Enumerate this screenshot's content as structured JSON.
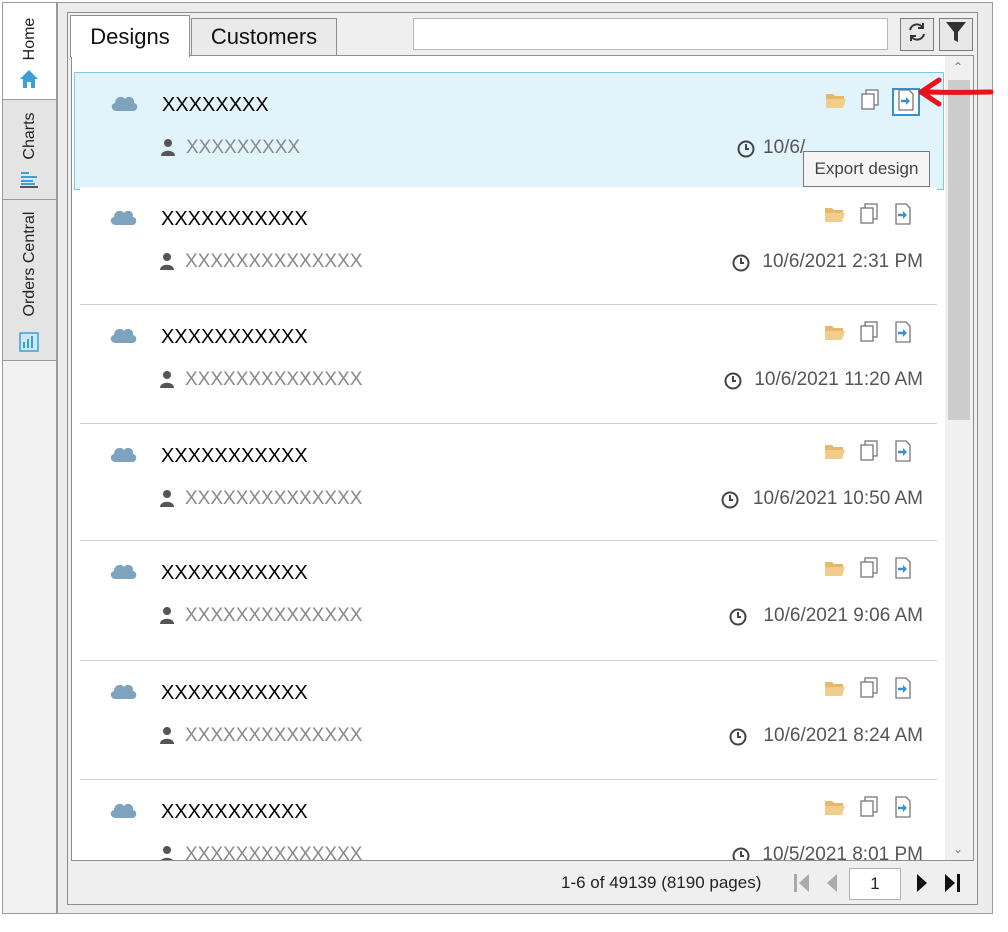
{
  "sidenav": {
    "tabs": [
      {
        "label": "Home",
        "icon": "home-icon"
      },
      {
        "label": "Charts",
        "icon": "bar-chart-icon"
      },
      {
        "label": "Orders Central",
        "icon": "orders-icon"
      }
    ]
  },
  "tabs": [
    {
      "label": "Designs"
    },
    {
      "label": "Customers"
    }
  ],
  "search": {
    "value": "",
    "placeholder": ""
  },
  "toolbar": {
    "refresh_icon": "refresh-icon",
    "filter_icon": "filter-icon"
  },
  "tooltip": "Export design",
  "designs": [
    {
      "name": "XXXXXXXX",
      "user": "XXXXXXXXX",
      "date": "10/6/"
    },
    {
      "name": "XXXXXXXXXXX",
      "user": "XXXXXXXXXXXXXX",
      "date": "10/6/2021 2:31 PM"
    },
    {
      "name": "XXXXXXXXXXX",
      "user": "XXXXXXXXXXXXXX",
      "date": "10/6/2021 11:20 AM"
    },
    {
      "name": "XXXXXXXXXXX",
      "user": "XXXXXXXXXXXXXX",
      "date": "10/6/2021 10:50 AM"
    },
    {
      "name": "XXXXXXXXXXX",
      "user": "XXXXXXXXXXXXXX",
      "date": "10/6/2021 9:06 AM"
    },
    {
      "name": "XXXXXXXXXXX",
      "user": "XXXXXXXXXXXXXX",
      "date": "10/6/2021 8:24 AM"
    },
    {
      "name": "XXXXXXXXXXX",
      "user": "XXXXXXXXXXXXXX",
      "date": "10/5/2021 8:01 PM"
    }
  ],
  "pager": {
    "info": "1-6 of 49139 (8190 pages)",
    "page": "1"
  },
  "colors": {
    "accent": "#3a8fd0",
    "selected_bg": "#e1f3fb",
    "cloud": "#7ea3bf",
    "folder": "#e8b86a",
    "annotation": "#e8141c"
  }
}
